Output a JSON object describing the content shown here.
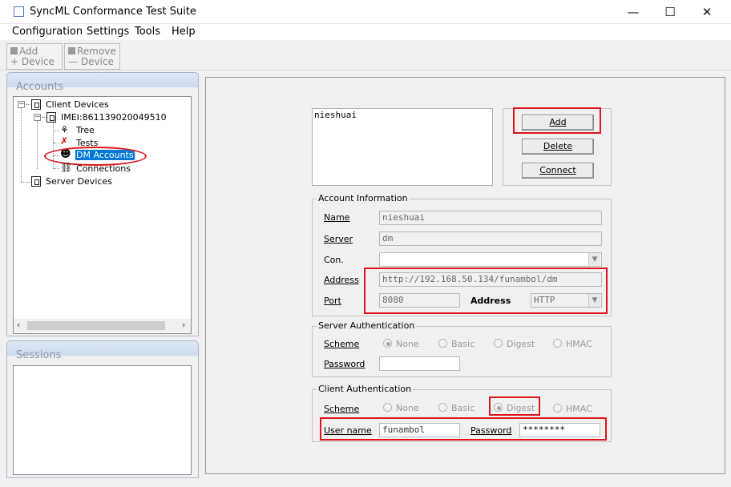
{
  "window": {
    "title": "SyncML Conformance Test Suite",
    "controls": {
      "minimize": "—",
      "maximize": "☐",
      "close": "✕"
    }
  },
  "menu": [
    "Configuration",
    "Settings",
    "Tools",
    "Help"
  ],
  "toolbar": {
    "add_device": {
      "line1": "Add",
      "line2": "Device"
    },
    "remove_device": {
      "line1": "Remove",
      "line2": "Device"
    }
  },
  "accounts_pane": {
    "title": "Accounts",
    "tree": {
      "client_devices": "Client Devices",
      "device": "IMEI:861139020049510",
      "tree": "Tree",
      "tests": "Tests",
      "dm_accounts": "DM Accounts",
      "connections": "Connections",
      "server_devices": "Server Devices"
    }
  },
  "sessions_pane": {
    "title": "Sessions"
  },
  "accounts_list": [
    "nieshuai"
  ],
  "buttons": {
    "add": "Add",
    "delete": "Delete",
    "connect": "Connect"
  },
  "account_info": {
    "title": "Account Information",
    "name_label": "Name",
    "name_value": "nieshuai",
    "server_label": "Server",
    "server_value": "dm",
    "con_label": "Con.",
    "con_value": "",
    "address_label": "Address",
    "address_value": "http://192.168.50.134/funambol/dm",
    "port_label": "Port",
    "port_value": "8080",
    "address_type_label": "Address",
    "address_type_value": "HTTP"
  },
  "server_auth": {
    "title": "Server Authentication",
    "scheme_label": "Scheme",
    "options": [
      "None",
      "Basic",
      "Digest",
      "HMAC"
    ],
    "selected": "None",
    "password_label": "Password",
    "password_value": ""
  },
  "client_auth": {
    "title": "Client Authentication",
    "scheme_label": "Scheme",
    "options": [
      "None",
      "Basic",
      "Digest",
      "HMAC"
    ],
    "selected": "Digest",
    "username_label": "User name",
    "username_value": "funambol",
    "password_label": "Password",
    "password_value": "********"
  },
  "colors": {
    "annotation": "#e0141c",
    "selection": "#0078d7"
  }
}
